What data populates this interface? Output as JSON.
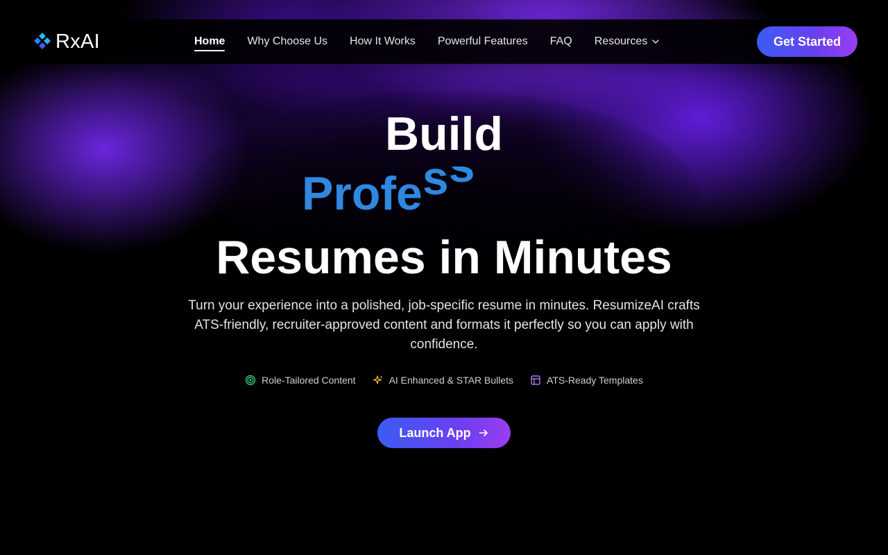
{
  "brand": {
    "name": "RxAI",
    "logo_icon": "diamond-logo-icon",
    "accent": "#3b5cf2"
  },
  "nav": {
    "items": [
      {
        "label": "Home",
        "active": true
      },
      {
        "label": "Why Choose Us"
      },
      {
        "label": "How It Works"
      },
      {
        "label": "Powerful Features"
      },
      {
        "label": "FAQ"
      },
      {
        "label": "Resources",
        "icon": "chevron-down-icon"
      }
    ],
    "cta_label": "Get Started"
  },
  "hero": {
    "line1": "Build",
    "line2_visible": [
      "P",
      "r",
      "o",
      "f",
      "e",
      "s",
      "s",
      "-"
    ],
    "line3": "Resumes in Minutes",
    "subtitle": "Turn your experience into a polished, job-specific resume in minutes. ResumizeAI crafts ATS-friendly, recruiter-approved content and formats it perfectly so you can apply with confidence.",
    "highlight_color": "#2f88e0"
  },
  "features": [
    {
      "label": "Role-Tailored Content",
      "icon": "target-icon",
      "color": "#34c77b"
    },
    {
      "label": "AI Enhanced & STAR Bullets",
      "icon": "sparkle-icon",
      "color": "#f2b63a"
    },
    {
      "label": "ATS-Ready Templates",
      "icon": "layout-icon",
      "color": "#b07cf0"
    }
  ],
  "cta": {
    "label": "Launch App",
    "icon": "arrow-right-icon"
  }
}
